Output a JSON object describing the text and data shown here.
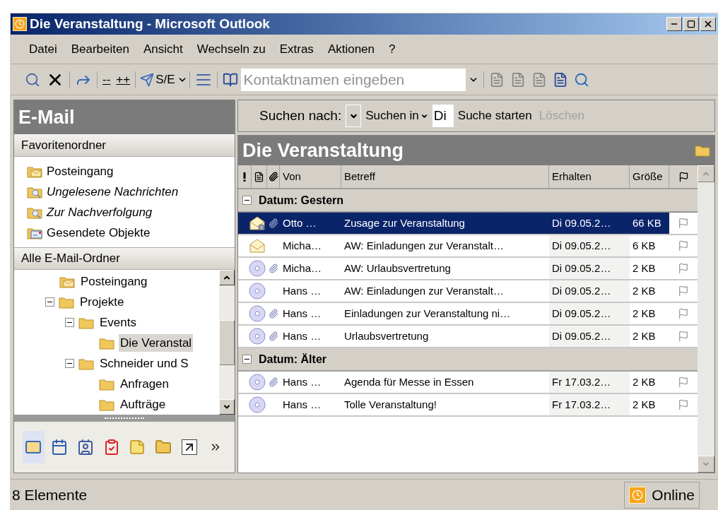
{
  "window": {
    "title": "Die Veranstaltung - Microsoft Outlook"
  },
  "menu": [
    {
      "label": "Datei"
    },
    {
      "label": "Bearbeiten"
    },
    {
      "label": "Ansicht"
    },
    {
      "label": "Wechseln zu"
    },
    {
      "label": "Extras"
    },
    {
      "label": "Aktionen"
    },
    {
      "label": "?"
    }
  ],
  "toolbar": {
    "collapse": "--",
    "expand": "++",
    "send_receive": "S/E",
    "contact_search": {
      "placeholder": "Kontaktnamen eingeben"
    }
  },
  "navigation": {
    "title": "E-Mail",
    "favorites": {
      "title": "Favoritenordner",
      "items": [
        {
          "label": "Posteingang",
          "kind": "inbox",
          "italic": false
        },
        {
          "label": "Ungelesene Nachrichten",
          "kind": "search",
          "italic": true
        },
        {
          "label": "Zur Nachverfolgung",
          "kind": "search",
          "italic": true
        },
        {
          "label": "Gesendete Objekte",
          "kind": "sent",
          "italic": false
        }
      ]
    },
    "all_folders": {
      "title": "Alle E-Mail-Ordner",
      "tree": [
        {
          "label": "Posteingang",
          "kind": "inbox",
          "selected": false
        },
        {
          "label": "Projekte",
          "kind": "folder",
          "selected": false,
          "expanded": true,
          "children": [
            {
              "label": "Events",
              "kind": "folder",
              "selected": false,
              "expanded": true,
              "children": [
                {
                  "label": "Die Veranstal",
                  "kind": "folder",
                  "selected": true
                }
              ]
            },
            {
              "label": "Schneider und S",
              "kind": "folder",
              "selected": false,
              "expanded": true,
              "children": [
                {
                  "label": "Anfragen",
                  "kind": "folder",
                  "selected": false
                },
                {
                  "label": "Aufträge",
                  "kind": "folder",
                  "selected": false
                }
              ]
            }
          ]
        }
      ]
    },
    "buttons": [
      {
        "kind": "mail",
        "selected": true
      },
      {
        "kind": "calendar",
        "selected": false
      },
      {
        "kind": "contacts",
        "selected": false
      },
      {
        "kind": "tasks",
        "selected": false
      },
      {
        "kind": "notes",
        "selected": false
      },
      {
        "kind": "folders",
        "selected": false
      },
      {
        "kind": "shortcuts",
        "selected": false
      },
      {
        "kind": "more",
        "selected": false
      }
    ]
  },
  "search": {
    "label": "Suchen nach:",
    "search_in": "Suchen in",
    "query": "Di",
    "start": "Suche starten",
    "clear": {
      "label": "Löschen",
      "disabled": true
    }
  },
  "folder": {
    "title": "Die Veranstaltung"
  },
  "columns": [
    "Von",
    "Betreff",
    "Erhalten",
    "Größe"
  ],
  "groups": [
    {
      "label": "Datum: Gestern",
      "expanded": true,
      "rows": [
        {
          "kind": "response",
          "attachment": true,
          "from": "Otto …",
          "subject": "Zusage zur Veranstaltung",
          "received": "Di 09.05.2…",
          "size": "66 KB",
          "selected": true
        },
        {
          "kind": "envelope",
          "attachment": false,
          "from": "Micha…",
          "subject": "AW: Einladungen zur Veranstalt…",
          "received": "Di 09.05.2…",
          "size": "6 KB",
          "selected": false
        },
        {
          "kind": "disc",
          "attachment": true,
          "from": "Micha…",
          "subject": "AW: Urlaubsvertretung",
          "received": "Di 09.05.2…",
          "size": "2 KB",
          "selected": false
        },
        {
          "kind": "disc",
          "attachment": false,
          "from": "Hans …",
          "subject": "AW: Einladungen zur Veranstalt…",
          "received": "Di 09.05.2…",
          "size": "2 KB",
          "selected": false
        },
        {
          "kind": "disc",
          "attachment": true,
          "from": "Hans …",
          "subject": "Einladungen zur Veranstaltung ni…",
          "received": "Di 09.05.2…",
          "size": "2 KB",
          "selected": false
        },
        {
          "kind": "disc",
          "attachment": true,
          "from": "Hans …",
          "subject": "Urlaubsvertretung",
          "received": "Di 09.05.2…",
          "size": "2 KB",
          "selected": false
        }
      ]
    },
    {
      "label": "Datum: Älter",
      "expanded": true,
      "rows": [
        {
          "kind": "disc",
          "attachment": true,
          "from": "Hans …",
          "subject": "Agenda für Messe in Essen",
          "received": "Fr 17.03.2…",
          "size": "2 KB",
          "selected": false
        },
        {
          "kind": "disc",
          "attachment": false,
          "from": "Hans …",
          "subject": "Tolle Veranstaltung!",
          "received": "Fr 17.03.2…",
          "size": "2 KB",
          "selected": false
        }
      ]
    }
  ],
  "status_bar": {
    "count": "8 Elemente",
    "connection": "Online"
  }
}
